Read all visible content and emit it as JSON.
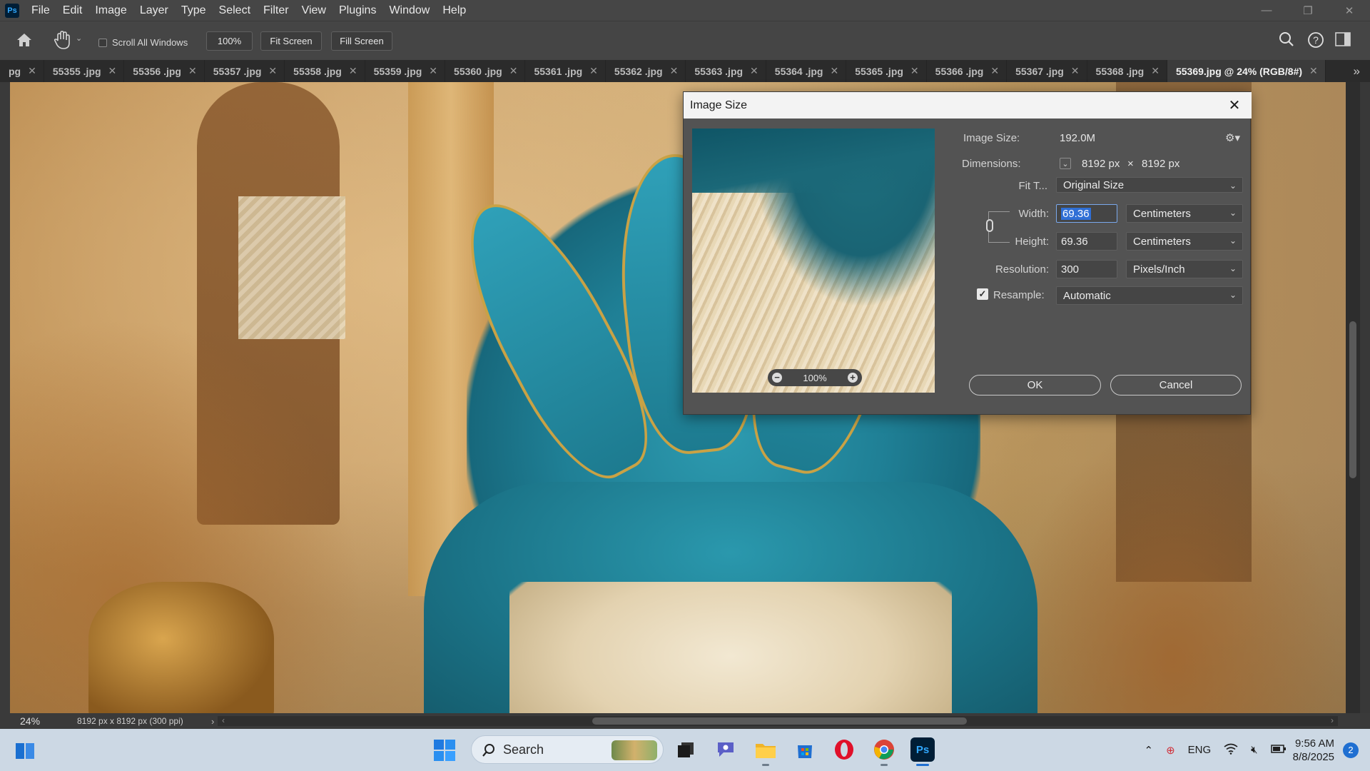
{
  "menu": {
    "logo": "Ps",
    "items": [
      "File",
      "Edit",
      "Image",
      "Layer",
      "Type",
      "Select",
      "Filter",
      "View",
      "Plugins",
      "Window",
      "Help"
    ]
  },
  "window_controls": {
    "minimize": "—",
    "restore": "❐",
    "close": "✕"
  },
  "options_bar": {
    "scroll_all_windows": "Scroll All Windows",
    "zoom": "100%",
    "fit_screen": "Fit Screen",
    "fill_screen": "Fill Screen"
  },
  "tabs": [
    {
      "label": "pg",
      "active": false
    },
    {
      "label": "55355 .jpg",
      "active": false
    },
    {
      "label": "55356 .jpg",
      "active": false
    },
    {
      "label": "55357 .jpg",
      "active": false
    },
    {
      "label": "55358 .jpg",
      "active": false
    },
    {
      "label": "55359 .jpg",
      "active": false
    },
    {
      "label": "55360 .jpg",
      "active": false
    },
    {
      "label": "55361 .jpg",
      "active": false
    },
    {
      "label": "55362 .jpg",
      "active": false
    },
    {
      "label": "55363 .jpg",
      "active": false
    },
    {
      "label": "55364 .jpg",
      "active": false
    },
    {
      "label": "55365 .jpg",
      "active": false
    },
    {
      "label": "55366 .jpg",
      "active": false
    },
    {
      "label": "55367 .jpg",
      "active": false
    },
    {
      "label": "55368 .jpg",
      "active": false
    },
    {
      "label": "55369.jpg @ 24% (RGB/8#)",
      "active": true
    }
  ],
  "tab_close_glyph": "✕",
  "status": {
    "zoom": "24%",
    "doc_info": "8192 px x 8192 px (300 ppi)",
    "caret": "›"
  },
  "dialog": {
    "title": "Image Size",
    "close": "✕",
    "preview_zoom": "100%",
    "image_size_label": "Image Size:",
    "image_size_value": "192.0M",
    "dimensions_label": "Dimensions:",
    "dim_width": "8192 px",
    "dim_times": "×",
    "dim_height": "8192 px",
    "fit_to_label": "Fit T...",
    "fit_to_value": "Original Size",
    "width_label": "Width:",
    "width_value": "69.36",
    "width_unit": "Centimeters",
    "height_label": "Height:",
    "height_value": "69.36",
    "height_unit": "Centimeters",
    "resolution_label": "Resolution:",
    "resolution_value": "300",
    "resolution_unit": "Pixels/Inch",
    "resample_label": "Resample:",
    "resample_value": "Automatic",
    "resample_checked": true,
    "ok": "OK",
    "cancel": "Cancel"
  },
  "taskbar": {
    "search": "Search",
    "language": "ENG",
    "time": "9:56 AM",
    "date": "8/8/2025",
    "notifications": "2"
  },
  "colors": {
    "accent": "#31a8ff",
    "selection": "#2f6fd6",
    "taskbar_active": "#1f6fd1"
  }
}
